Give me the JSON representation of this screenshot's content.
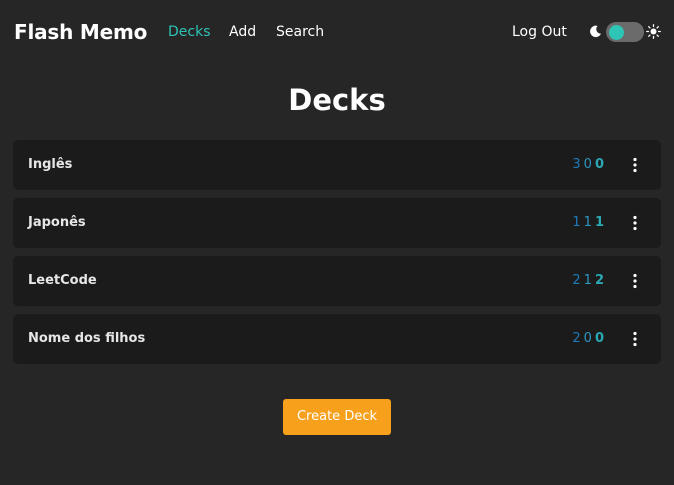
{
  "header": {
    "brand": "Flash Memo",
    "nav": [
      {
        "label": "Decks",
        "active": true
      },
      {
        "label": "Add",
        "active": false
      },
      {
        "label": "Search",
        "active": false
      }
    ],
    "logout_label": "Log Out",
    "theme_toggle": {
      "left_icon": "moon-icon",
      "right_icon": "sun-icon",
      "knob_color": "#2ec4b6"
    }
  },
  "main": {
    "title": "Decks",
    "decks": [
      {
        "name": "Inglês",
        "counts": [
          "3",
          "0",
          "0"
        ]
      },
      {
        "name": "Japonês",
        "counts": [
          "1",
          "1",
          "1"
        ]
      },
      {
        "name": "LeetCode",
        "counts": [
          "2",
          "1",
          "2"
        ]
      },
      {
        "name": "Nome dos filhos",
        "counts": [
          "2",
          "0",
          "0"
        ]
      }
    ],
    "create_button_label": "Create Deck"
  },
  "colors": {
    "background": "#262626",
    "card": "#1b1b1b",
    "accent": "#2ec4b6",
    "button": "#f7a01c",
    "count_new": "#1f7ab8",
    "count_learn": "#2f96c0",
    "count_review": "#2aa8b3"
  }
}
